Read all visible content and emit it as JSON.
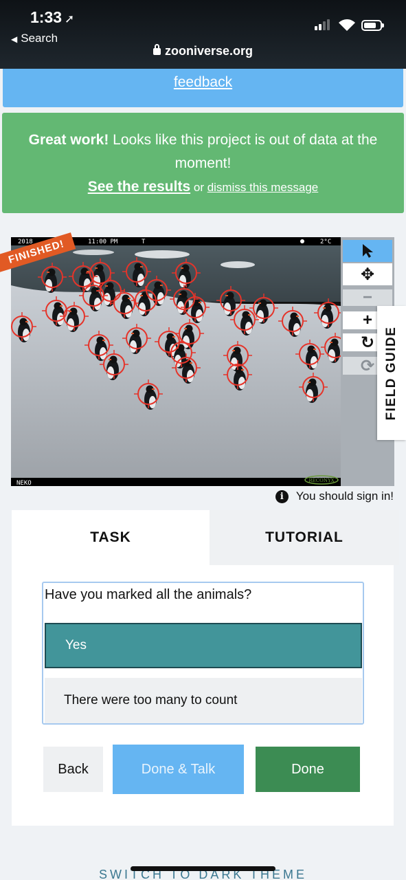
{
  "status_bar": {
    "time": "1:33",
    "back_label": "Search",
    "url": "zooniverse.org"
  },
  "feedback_banner": {
    "link": "feedback"
  },
  "success_banner": {
    "bold": "Great work!",
    "text": " Looks like this project is out of data at the moment!",
    "results_link": "See the results",
    "or": " or ",
    "dismiss_link": "dismiss this message"
  },
  "subject": {
    "badge": "FINISHED!",
    "camera_top_left": "2018",
    "camera_time": "11:00 PM",
    "camera_t": "T",
    "camera_temp": "2°C",
    "camera_bottom": "NEKO",
    "camera_brand": "RECONYX"
  },
  "toolbar": {
    "pointer_icon": "pointer-icon",
    "move_icon": "move-icon",
    "zoom_out_icon": "minus-icon",
    "zoom_in_icon": "plus-icon",
    "rotate_icon": "rotate-icon",
    "reset_icon": "reset-icon"
  },
  "field_guide": "FIELD GUIDE",
  "signin_notice": "You should sign in!",
  "tabs": {
    "task": "TASK",
    "tutorial": "TUTORIAL"
  },
  "task": {
    "question": "Have you marked all the animals?",
    "answers": [
      "Yes",
      "There were too many to count"
    ],
    "selected": "Yes"
  },
  "buttons": {
    "back": "Back",
    "done_talk": "Done & Talk",
    "done": "Done"
  },
  "footer": {
    "theme_switch": "SWITCH TO DARK THEME"
  },
  "colors": {
    "accent_blue": "#65b5f2",
    "success_green": "#63b873",
    "done_green": "#3c8c53",
    "selected_teal": "#42959a",
    "marker_red": "#e5342a",
    "badge_orange": "#e15a24"
  }
}
